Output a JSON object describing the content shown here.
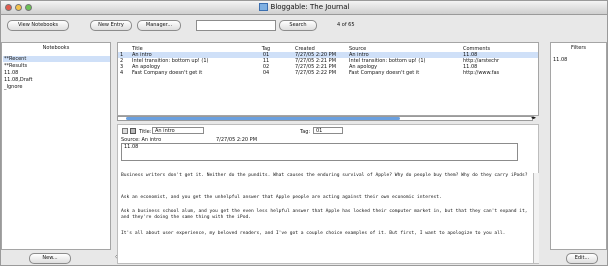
{
  "window": {
    "title": "Bloggable: The Journal"
  },
  "toolbar": {
    "view_notebooks": "View Notebooks",
    "new_entry": "New Entry",
    "manager": "Manager...",
    "search": "Search",
    "count": "4 of 65"
  },
  "notebooks": {
    "header": "Notebooks",
    "items": [
      "**Recent",
      "**Results",
      "11.08",
      "11.08,Draft",
      "_Ignore"
    ],
    "new_button": "New..."
  },
  "entries": {
    "columns": [
      "",
      "Title",
      "Tag",
      "Created",
      "Source",
      "Comments"
    ],
    "rows": [
      [
        "1",
        "An intro",
        "01",
        "7/27/05 2:20 PM",
        "An intro",
        "11.08"
      ],
      [
        "2",
        "Intel transition: bottom up! (1)",
        "11",
        "7/27/05 2:21 PM",
        "Intel transition: bottom up! (1)",
        "http://arstechr"
      ],
      [
        "3",
        "An apology",
        "02",
        "7/27/05 2:21 PM",
        "An apology",
        "11.08"
      ],
      [
        "4",
        "Fast Company doesn't get it",
        "04",
        "7/27/05 2:22 PM",
        "Fast Company doesn't get it",
        "http://www.fas"
      ]
    ]
  },
  "editor": {
    "title_label": "Title:",
    "title_value": "An intro",
    "tag_label": "Tag:",
    "tag_value": "01",
    "source_line": "Source: An intro",
    "created": "7/27/05 2:20 PM",
    "comment_box": "11.08",
    "paragraphs": [
      "Business writers don't get it. Neither do the pundits. What causes the enduring survival of Apple? Why do people buy them? Why do they carry iPods?",
      "Ask an economist, and you get the unhelpful answer that Apple people are acting against their own economic interest.",
      "Ask a business school alum, and you get the even less helpful answer that Apple has locked their computer market in, but that they can't expand it, and they're doing the same thing with the iPod.",
      "It's all about user experience, my beloved readers, and I've got a couple choice examples of it. But first, I want to apologize to you all."
    ]
  },
  "filters": {
    "header": "Filters",
    "items": [
      "11.08"
    ],
    "edit_button": "Edit..."
  },
  "colors": {
    "accent": "#6aa0e0",
    "selection": "#cfe0f8"
  }
}
